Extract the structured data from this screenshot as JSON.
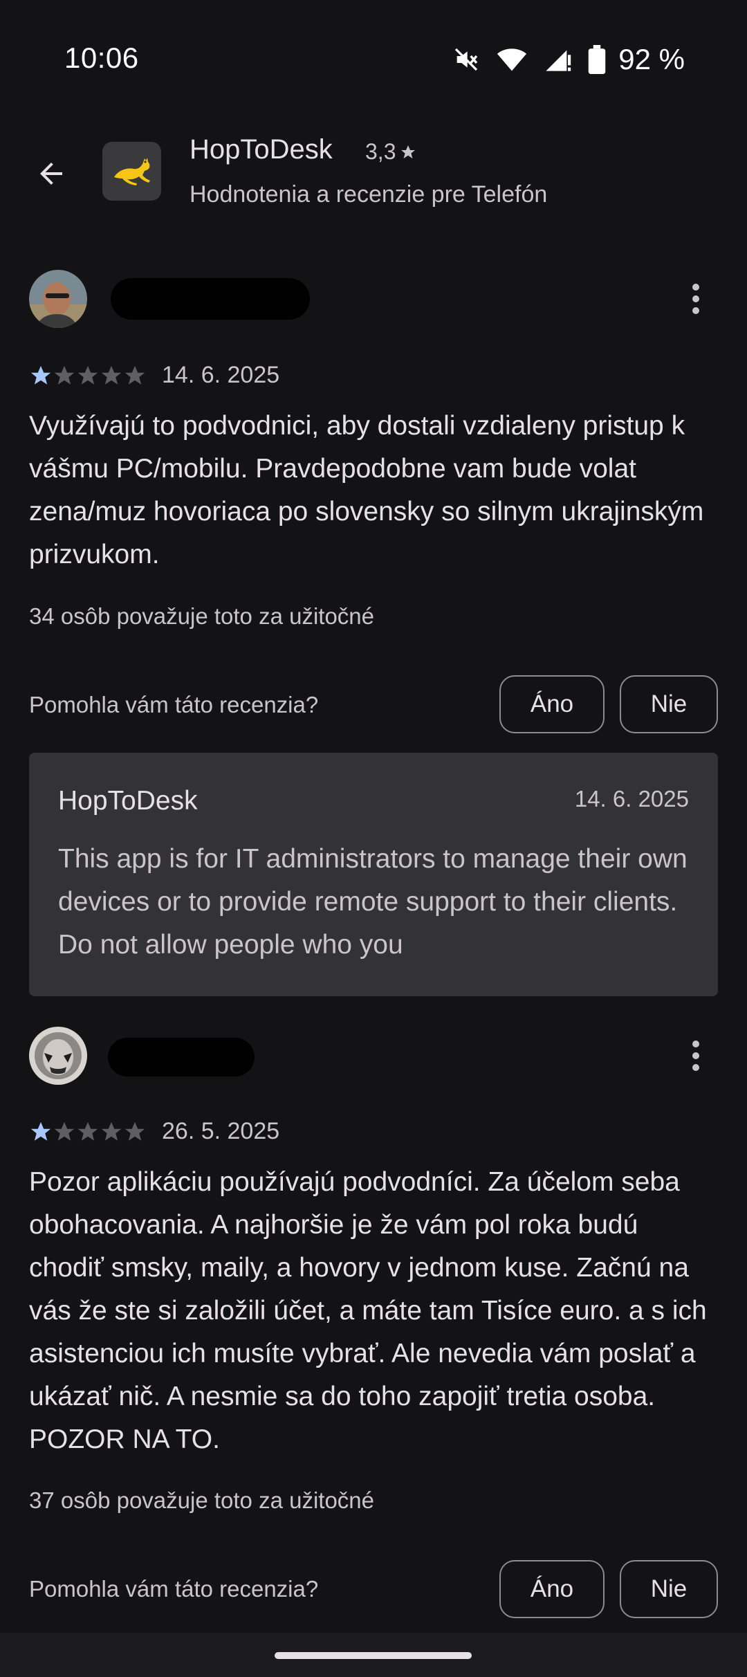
{
  "status_bar": {
    "time": "10:06",
    "battery": "92 %",
    "icons": [
      "mute-icon",
      "wifi-icon",
      "signal-icon",
      "battery-icon"
    ]
  },
  "header": {
    "app_name": "HopToDesk",
    "rating": "3,3",
    "subtitle": "Hodnotenia a recenzie pre Telefón"
  },
  "reviews": [
    {
      "stars": 1,
      "date": "14. 6. 2025",
      "text": "Využívajú to podvodnici, aby dostali vzdialeny pristup k vášmu PC/mobilu. Pravdepodobne vam bude volat zena/muz hovoriaca po slovensky so silnym ukrajinským prizvukom.",
      "helpful_count": "34 osôb považuje toto za užitočné",
      "helpful_question": "Pomohla vám táto recenzia?",
      "yes_label": "Áno",
      "no_label": "Nie",
      "developer_reply": {
        "name": "HopToDesk",
        "date": "14. 6. 2025",
        "text": "This app is for IT administrators to manage their own devices or to provide remote support to their clients. Do not allow people who you"
      }
    },
    {
      "stars": 1,
      "date": "26. 5. 2025",
      "text": "Pozor aplikáciu používajú podvodníci. Za účelom seba obohacovania. A najhoršie je že vám pol roka budú chodiť smsky, maily, a hovory v jednom kuse. Začnú na vás že ste si založili účet, a máte tam Tisíce euro. a s ich asistenciou ich musíte vybrať. Ale nevedia vám poslať a ukázať nič. A nesmie sa do toho zapojiť tretia osoba. POZOR NA TO.",
      "helpful_count": "37 osôb považuje toto za užitočné",
      "helpful_question": "Pomohla vám táto recenzia?",
      "yes_label": "Áno",
      "no_label": "Nie"
    }
  ],
  "colors": {
    "background": "#131315",
    "star_filled": "#a8c7fa",
    "star_empty": "#5f5e62",
    "reply_bg": "#333235",
    "app_icon_accent": "#f5c518"
  }
}
